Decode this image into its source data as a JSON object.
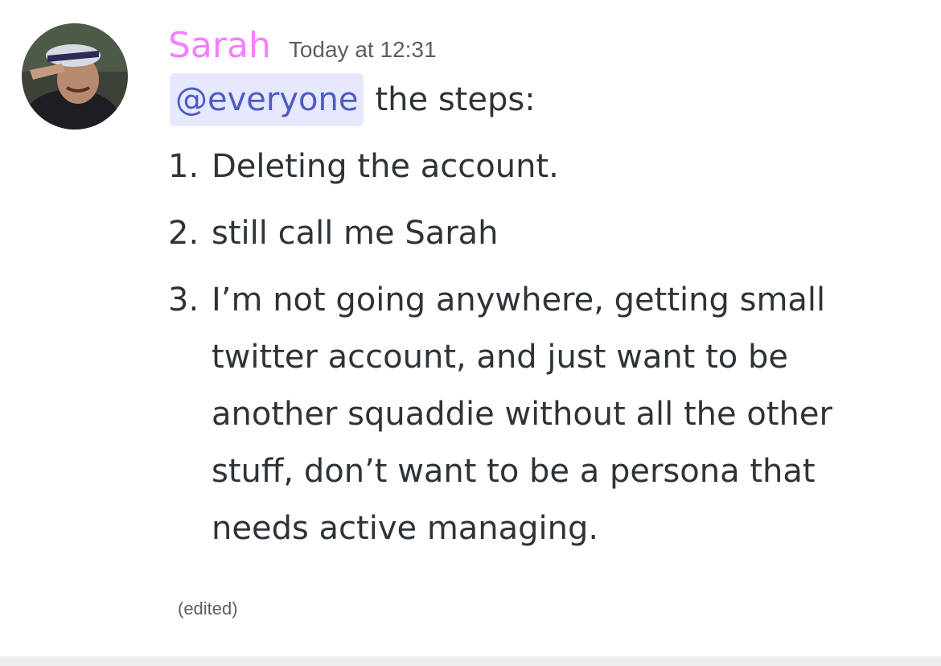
{
  "message": {
    "author": "Sarah",
    "author_color": "#f47fff",
    "timestamp": "Today at 12:31",
    "mention": "@everyone",
    "intro_text": "the steps:",
    "steps": [
      {
        "num": "1.",
        "text": "Deleting the account."
      },
      {
        "num": "2.",
        "text": "still call me Sarah"
      },
      {
        "num": "3.",
        "text": "I’m not going anywhere, getting small twitter account, and just want to be another squaddie without all the other stuff, don’t want to be a persona that needs active managing."
      }
    ],
    "edited_label": "(edited)"
  },
  "colors": {
    "mention_bg": "#e6e8fd",
    "mention_text": "#4e5ac5",
    "body_text": "#2e3338",
    "muted_text": "#5c5e66"
  }
}
